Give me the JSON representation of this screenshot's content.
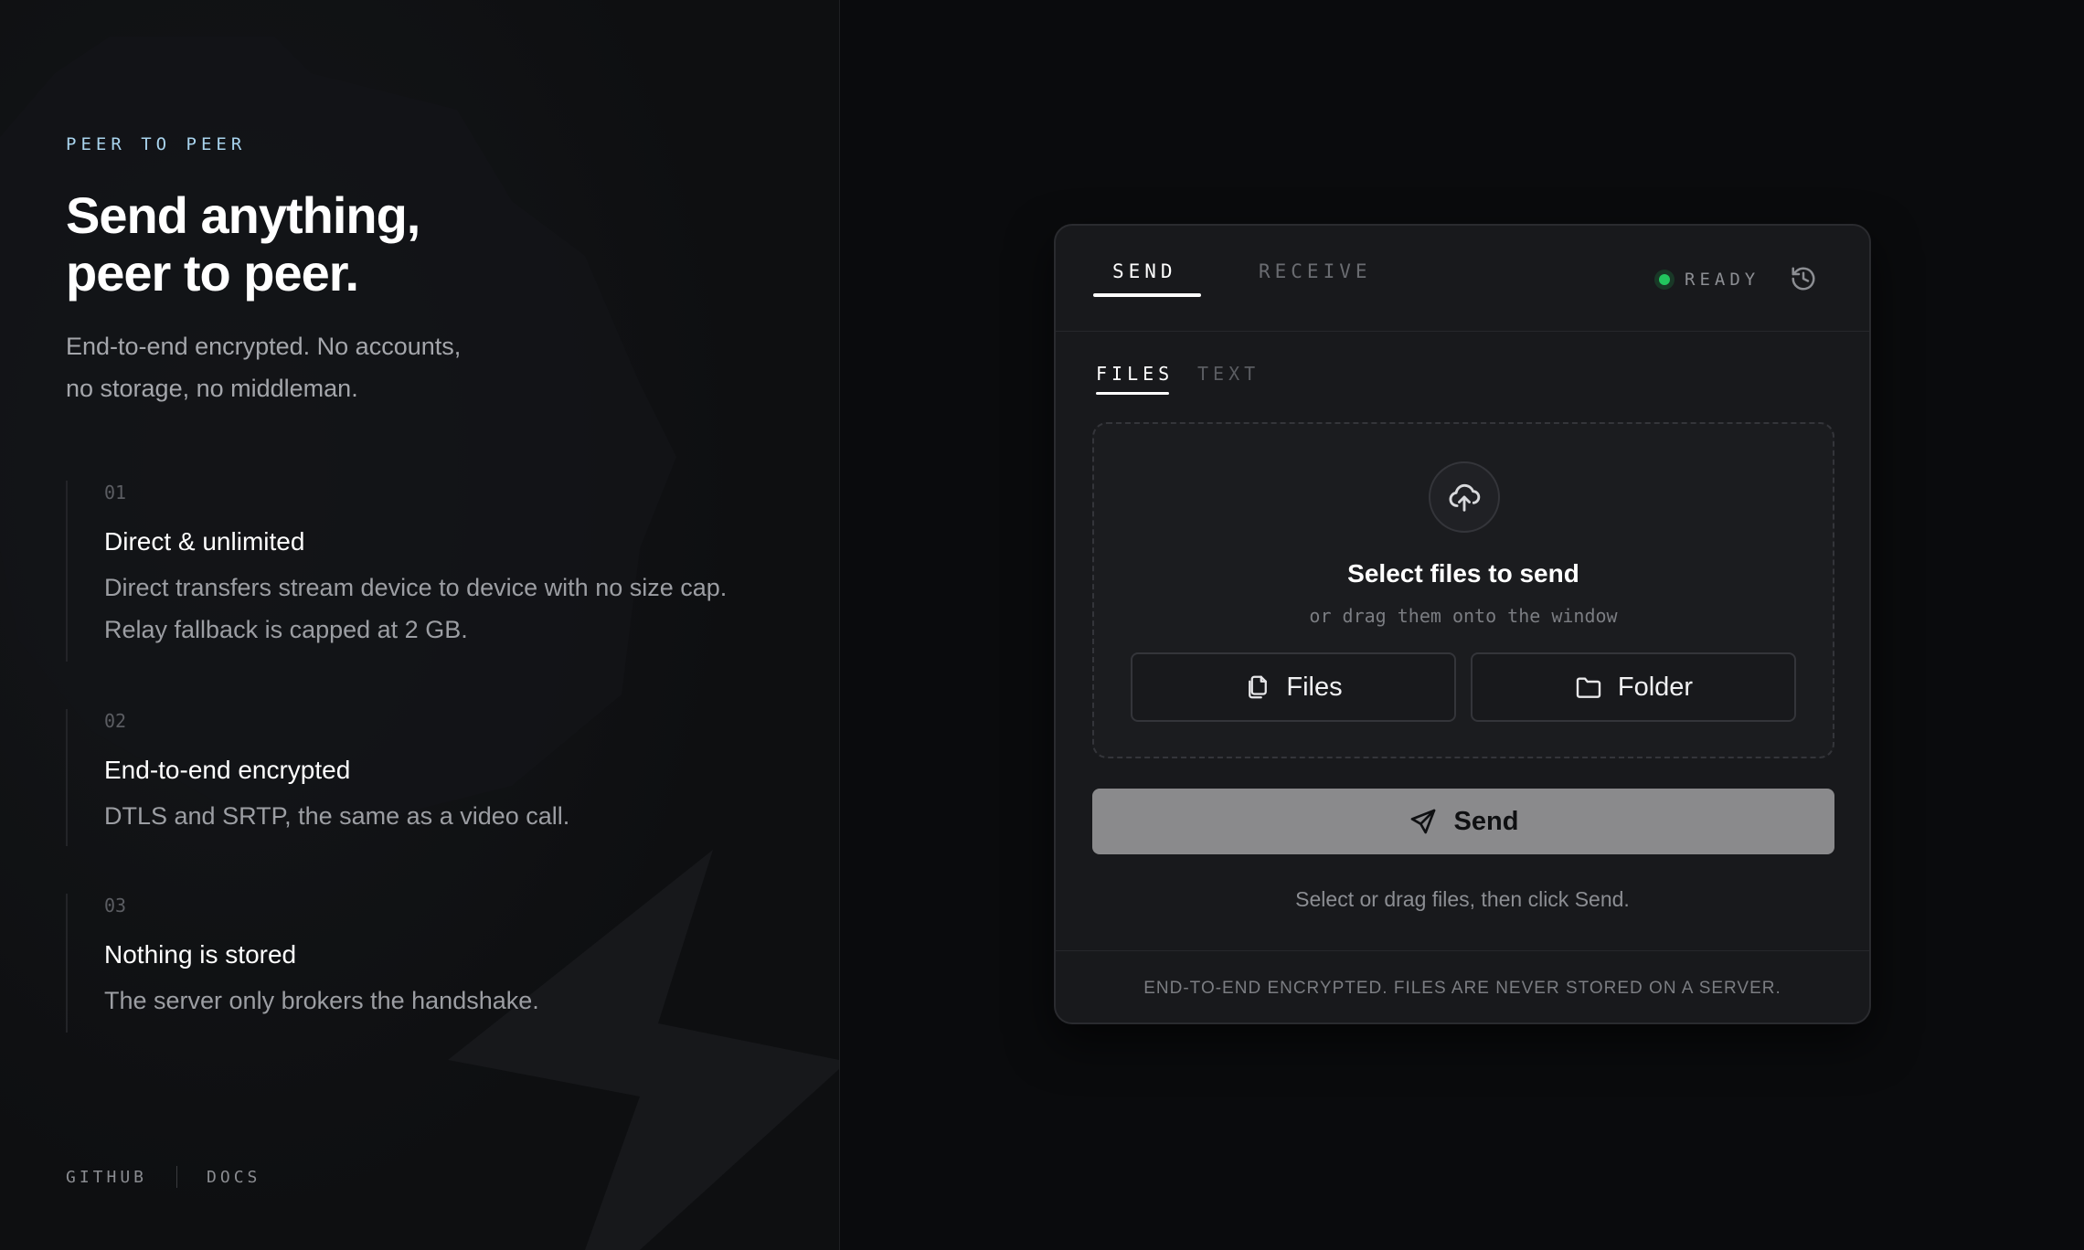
{
  "hero": {
    "eyebrow": "PEER TO PEER",
    "headline_line1": "Send anything,",
    "headline_line2": "peer to peer.",
    "lede_line1": "End-to-end encrypted. No accounts,",
    "lede_line2": "no storage, no middleman."
  },
  "features": [
    {
      "number": "01",
      "title": "Direct & unlimited",
      "desc_line1": "Direct transfers stream device to device with no size cap.",
      "desc_line2": "Relay fallback is capped at 2 GB."
    },
    {
      "number": "02",
      "title": "End-to-end encrypted",
      "desc_line1": "DTLS and SRTP, the same as a video call."
    },
    {
      "number": "03",
      "title": "Nothing is stored",
      "desc_line1": "The server only brokers the handshake."
    }
  ],
  "footer_links": {
    "github": "GITHUB",
    "docs": "DOCS"
  },
  "card": {
    "tabs": {
      "send": "SEND",
      "receive": "RECEIVE"
    },
    "status": "READY",
    "history_icon": "history-icon",
    "subtabs": {
      "files": "FILES",
      "text": "TEXT"
    },
    "dropzone": {
      "icon": "cloud-upload-icon",
      "title": "Select files to send",
      "subtitle": "or drag them onto the window",
      "files_button": "Files",
      "folder_button": "Folder"
    },
    "send_button": "Send",
    "hint": "Select or drag files, then click Send.",
    "footer_note": "END-TO-END ENCRYPTED. FILES ARE NEVER STORED ON A SERVER."
  },
  "colors": {
    "status_ready": "#22c55e",
    "eyebrow": "#a9d4ee",
    "send_button_bg": "#8a8a8c"
  }
}
